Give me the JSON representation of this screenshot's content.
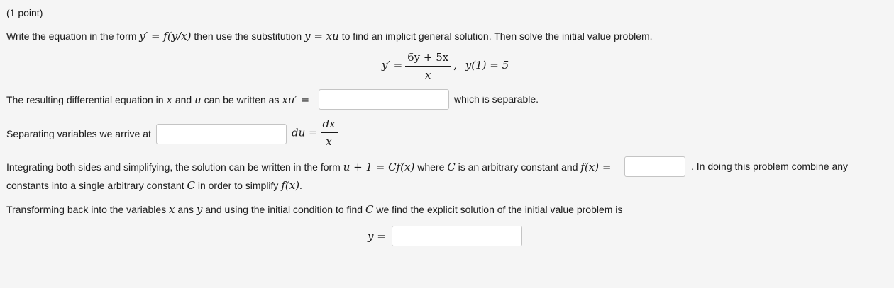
{
  "header": {
    "points": "(1 point)"
  },
  "intro": {
    "t1": "Write the equation in the form",
    "eq1": "y′ = f(y/x)",
    "t2": "then use the substitution",
    "eq2": "y = xu",
    "t3": "to find an implicit general solution. Then solve the initial value problem."
  },
  "ode": {
    "lhs": "y′ =",
    "numerator": "6y + 5x",
    "denominator": "x",
    "comma": ",",
    "initial": "y(1) = 5"
  },
  "q1": {
    "t1": "The resulting differential equation in",
    "x": "x",
    "and": "and",
    "u": "u",
    "t2": "can be written as",
    "lhs": "xu′ =",
    "answer": "",
    "after": "which is separable."
  },
  "q2": {
    "text": "Separating variables we arrive at",
    "answer": "",
    "du": "du =",
    "dx": "dx",
    "x": "x"
  },
  "q3": {
    "t1": "Integrating both sides and simplifying, the solution can be written in the form",
    "eq1": "u + 1 = Cf(x)",
    "t2": "where",
    "C": "C",
    "t3": "is an arbitrary constant and",
    "fx": "f(x) =",
    "answer": "",
    "t4": ". In doing this problem combine any",
    "l2a": "constants into a single arbitrary constant",
    "C2": "C",
    "l2b": "in order to simplify",
    "fx2": "f(x)",
    "dot": "."
  },
  "q4": {
    "t1": "Transforming back into the variables",
    "x": "x",
    "t2": "ans",
    "y": "y",
    "t3": "and using the initial condition to find",
    "C": "C",
    "t4": "we find the explicit solution of the initial value problem is",
    "lhs": "y =",
    "answer": ""
  }
}
